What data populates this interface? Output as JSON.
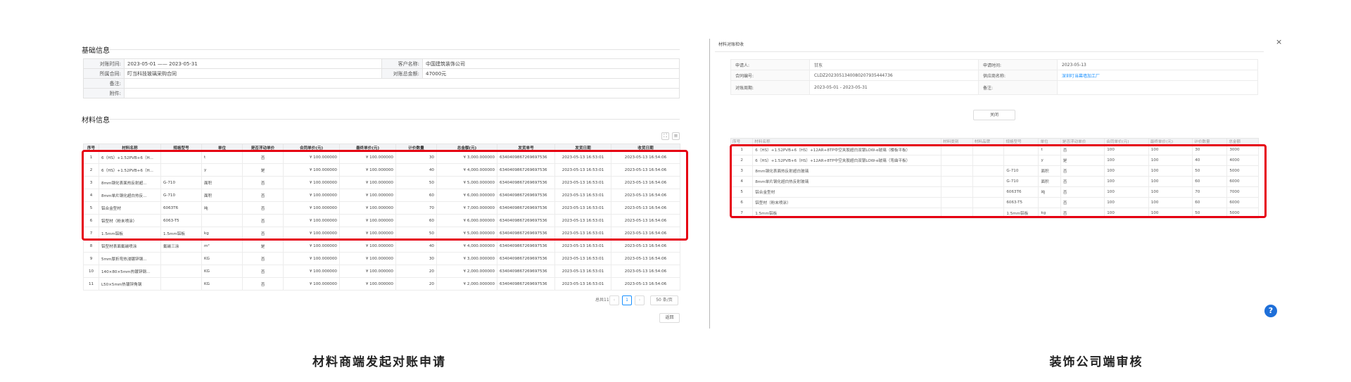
{
  "left": {
    "section_basic": "基础信息",
    "info": {
      "period_label": "对账时间:",
      "period_value": "2023-05-01 —— 2023-05-31",
      "customer_label": "客户名称:",
      "customer_value": "中国建筑装饰公司",
      "contract_label": "所属合同:",
      "contract_value": "叮当科技玻璃采购合同",
      "total_label": "对账总金额:",
      "total_value": "47000元",
      "remark_label": "备注:",
      "remark_value": "",
      "attach_label": "附件:",
      "attach_value": ""
    },
    "section_material": "材料信息",
    "columns": [
      "序号",
      "材料名称",
      "规格型号",
      "单位",
      "是否浮动单价",
      "合同单价(元)",
      "最终单价(元)",
      "计价数量",
      "总金额(元)",
      "发货单号",
      "发货日期",
      "收货日期"
    ],
    "rows": [
      [
        "1",
        "6（HS）+1.52PVB+6（H...",
        "",
        "t",
        "否",
        "¥ 100.000000",
        "¥ 100.000000",
        "30",
        "¥ 3,000.000000",
        "634040986726969753​6",
        "2023-05-13 16:53:01",
        "2023-05-13 16:54:06"
      ],
      [
        "2",
        "6（HS）+1.52PVB+6（H...",
        "",
        "y",
        "是",
        "¥ 100.000000",
        "¥ 100.000000",
        "40",
        "¥ 4,000.000000",
        "634040986726969753​6",
        "2023-05-13 16:53:01",
        "2023-05-13 16:54:06"
      ],
      [
        "3",
        "8mm钢化表面热反射超...",
        "G-710",
        "面积",
        "否",
        "¥ 100.000000",
        "¥ 100.000000",
        "50",
        "¥ 5,000.000000",
        "634040986726969753​6",
        "2023-05-13 16:53:01",
        "2023-05-13 16:54:06"
      ],
      [
        "4",
        "8mm单片钢化超白热反...",
        "G-710",
        "面积",
        "否",
        "¥ 100.000000",
        "¥ 100.000000",
        "60",
        "¥ 6,000.000000",
        "634040986726969753​6",
        "2023-05-13 16:53:01",
        "2023-05-13 16:54:06"
      ],
      [
        "5",
        "铝合金型材",
        "6063T6",
        "吨",
        "否",
        "¥ 100.000000",
        "¥ 100.000000",
        "70",
        "¥ 7,000.000000",
        "634040986726969753​6",
        "2023-05-13 16:53:01",
        "2023-05-13 16:54:06"
      ],
      [
        "6",
        "铝型材（粉末喷涂）",
        "6063-T5",
        "",
        "否",
        "¥ 100.000000",
        "¥ 100.000000",
        "60",
        "¥ 6,000.000000",
        "634040986726969753​6",
        "2023-05-13 16:53:01",
        "2023-05-13 16:54:06"
      ],
      [
        "7",
        "1.5mm铝板",
        "1.5mm铝板",
        "kg",
        "否",
        "¥ 100.000000",
        "¥ 100.000000",
        "50",
        "¥ 5,000.000000",
        "634040986726969753​6",
        "2023-05-13 16:53:01",
        "2023-05-13 16:54:06"
      ],
      [
        "8",
        "铝型材表面氟碳喷涂",
        "氟碳三涂",
        "m²",
        "是",
        "¥ 100.000000",
        "¥ 100.000000",
        "40",
        "¥ 4,000.000000",
        "634040986726969753​6",
        "2023-05-13 16:53:01",
        "2023-05-13 16:54:06"
      ],
      [
        "9",
        "5mm厚折弯热浸镀锌钢...",
        "",
        "KG",
        "否",
        "¥ 100.000000",
        "¥ 100.000000",
        "30",
        "¥ 3,000.000000",
        "634040986726969753​6",
        "2023-05-13 16:53:01",
        "2023-05-13 16:54:06"
      ],
      [
        "10",
        "140×80×5mm热镀锌钢...",
        "",
        "KG",
        "否",
        "¥ 100.000000",
        "¥ 100.000000",
        "20",
        "¥ 2,000.000000",
        "634040986726969753​6",
        "2023-05-13 16:53:01",
        "2023-05-13 16:54:06"
      ],
      [
        "11",
        "L50×5mm热镀锌角钢",
        "",
        "KG",
        "否",
        "¥ 100.000000",
        "¥ 100.000000",
        "20",
        "¥ 2,000.000000",
        "634040986726969753​6",
        "2023-05-13 16:53:01",
        "2023-05-13 16:54:06"
      ]
    ],
    "pager": {
      "total": "总共11条",
      "prev": "‹",
      "current": "1",
      "next": "›",
      "size": "50 条/页"
    },
    "back_label": "返回",
    "caption": "材料商端发起对账申请"
  },
  "right": {
    "dialog_title": "材料对账检收",
    "close_icon": "×",
    "form": {
      "applicant_label": "申请人:",
      "applicant_value": "甘东",
      "apply_time_label": "申请时间:",
      "apply_time_value": "2023-05-13",
      "contract_no_label": "合同编号:",
      "contract_no_value": "CLDZ2023051340080207935444736",
      "supplier_label": "供应商名称:",
      "supplier_value": "深圳叮当幕墙加工厂",
      "period_label": "对账周期:",
      "period_value": "2023-05-01 - 2023-05-31",
      "remark_label": "备注:",
      "remark_value": ""
    },
    "close_label": "关闭",
    "columns": [
      "序号",
      "材料名称",
      "材料类别",
      "材料品牌",
      "规格型号",
      "单位",
      "是否浮动单价",
      "合同单价(元)",
      "最终单价(元)",
      "计价数量",
      "总金额"
    ],
    "rows": [
      [
        "1",
        "6（HS）+1.52PVB+6（HS）+12AR+8TP中空夹胶超白双银LOW-e玻璃（楼板平板）",
        "",
        "",
        "",
        "t",
        "否",
        "100",
        "100",
        "30",
        "3000"
      ],
      [
        "2",
        "6（HS）+1.52PVB+6（HS）+12AR+8TP中空夹胶超白双银LOW-e玻璃（弯曲平板）",
        "",
        "",
        "",
        "y",
        "是",
        "100",
        "100",
        "40",
        "4000"
      ],
      [
        "3",
        "8mm钢化表面热反射超白玻璃",
        "",
        "",
        "G-710",
        "面积",
        "否",
        "100",
        "100",
        "50",
        "5000"
      ],
      [
        "4",
        "8mm单片钢化超白热反射玻璃",
        "",
        "",
        "G-710",
        "面积",
        "否",
        "100",
        "100",
        "60",
        "6000"
      ],
      [
        "5",
        "铝合金型材",
        "",
        "",
        "6063T6",
        "吨",
        "否",
        "100",
        "100",
        "70",
        "7000"
      ],
      [
        "6",
        "铝型材（粉末喷涂）",
        "",
        "",
        "6063-T5",
        "",
        "否",
        "100",
        "100",
        "60",
        "6000"
      ],
      [
        "7",
        "1.5mm铝板",
        "",
        "",
        "1.5mm铝板",
        "kg",
        "否",
        "100",
        "100",
        "50",
        "5000"
      ]
    ],
    "help_icon": "?",
    "caption": "装饰公司端审核"
  }
}
